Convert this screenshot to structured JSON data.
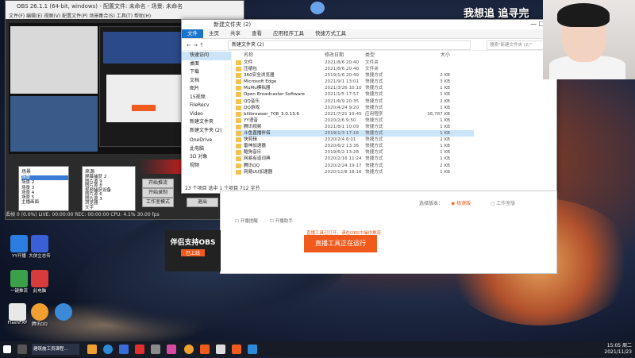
{
  "obs": {
    "title": "OBS 26.1.1 (64-bit, windows) - 配置文件: 未命名 - 场景: 未命名",
    "menu": "文件(F)  编辑(E)  视图(V)  配置文件(P)  场景集合(S)  工具(T)  帮助(H)",
    "scenes_header": "场景",
    "sources_header": "来源",
    "scenes": [
      "场景",
      "场景 2",
      "场景 3",
      "场景 4",
      "场景 5",
      "主播画面",
      "全屏游戏"
    ],
    "sources": [
      "屏幕捕获 2",
      "图片源 9",
      "图片源 8",
      "视频捕获设备",
      "图片源 6",
      "图片源 3",
      "浏览器",
      "文字",
      "文本(GDI+) 2"
    ],
    "controls": [
      "开始推流",
      "开始录制",
      "工作室模式",
      "设置",
      "退出"
    ],
    "status": "丢帧 0 (0.0%)  LIVE: 00:00:00  REC: 00:00:00  CPU: 4.1%  30.00 fps"
  },
  "explorer": {
    "title": "新建文件夹 (2)",
    "tabs": [
      "文件",
      "主页",
      "共享",
      "查看",
      "应用程序工具",
      "快捷方式工具"
    ],
    "path": "新建文件夹 (2)",
    "search_placeholder": "搜索\"新建文件夹 (2)\"",
    "columns": {
      "name": "名称",
      "date": "修改日期",
      "type": "类型",
      "size": "大小"
    },
    "sidebar": [
      "快速访问",
      "桌面",
      "下载",
      "文档",
      "图片",
      "15视频",
      "FileRecv",
      "Video",
      "新建文件夹",
      "新建文件夹 (2)",
      "OneDrive",
      "此电脑",
      "3D 对象",
      "视频"
    ],
    "files": [
      {
        "name": "文件",
        "date": "2021/8/6 20:40",
        "type": "文件夹",
        "size": ""
      },
      {
        "name": "压缩包",
        "date": "2021/8/6 20:40",
        "type": "文件夹",
        "size": ""
      },
      {
        "name": "360安全浏览器",
        "date": "2019/1/6 20:49",
        "type": "快捷方式",
        "size": "2 KB"
      },
      {
        "name": "Microsoft Edge",
        "date": "2021/9/1 13:01",
        "type": "快捷方式",
        "size": "3 KB"
      },
      {
        "name": "MuMu模拟器",
        "date": "2021/3/26 10:10",
        "type": "快捷方式",
        "size": "1 KB"
      },
      {
        "name": "Open Broadcaster Software",
        "date": "2021/1/5 17:57",
        "type": "快捷方式",
        "size": "1 KB"
      },
      {
        "name": "QQ音乐",
        "date": "2021/6/9 20:35",
        "type": "快捷方式",
        "size": "2 KB"
      },
      {
        "name": "QQ游戏",
        "date": "2020/4/24 9:20",
        "type": "快捷方式",
        "size": "1 KB"
      },
      {
        "name": "bilibrowser_708_3.0.13.6",
        "date": "2021/7/21 19:45",
        "type": "应用程序",
        "size": "36,787 KB"
      },
      {
        "name": "YY语音",
        "date": "2020/2/6 9:50",
        "type": "快捷方式",
        "size": "1 KB"
      },
      {
        "name": "腾讯视频",
        "date": "2021/8/1 10:09",
        "type": "快捷方式",
        "size": "1 KB"
      },
      {
        "name": "斗鱼直播伴侣",
        "date": "2019/1/3 17:16",
        "type": "快捷方式",
        "size": "1 KB"
      },
      {
        "name": "快剪辑",
        "date": "2020/2/4 8:01",
        "type": "快捷方式",
        "size": "2 KB"
      },
      {
        "name": "雷神加速器",
        "date": "2020/6/2 13:36",
        "type": "快捷方式",
        "size": "1 KB"
      },
      {
        "name": "酷狗音乐",
        "date": "2019/6/2 13:28",
        "type": "快捷方式",
        "size": "1 KB"
      },
      {
        "name": "网易有道词典",
        "date": "2020/2/16 11:24",
        "type": "快捷方式",
        "size": "1 KB"
      },
      {
        "name": "腾讯QQ",
        "date": "2020/2/24 19:17",
        "type": "快捷方式",
        "size": "2 KB"
      },
      {
        "name": "网易UU加速器",
        "date": "2020/12/8 18:16",
        "type": "快捷方式",
        "size": "1 KB"
      }
    ],
    "status": "23 个项目   选中 1 个项目 712 字节"
  },
  "browser": {
    "label_select": "选择版本：",
    "option1": "极速版",
    "option2": "工作室版",
    "checkbox1": "开播提醒",
    "checkbox2": "开播助手",
    "notice": "直播工具已打开，请在OBS中操作推流",
    "run_button": "直播工具正在运行"
  },
  "ad": {
    "line1": "伴侣支持OBS",
    "line2": "已上线"
  },
  "banner": "我想追 追寻完",
  "desktop_icons": [
    "YY开播",
    "大侠立志传",
    "一键推流",
    "此电脑",
    "FlashFXP",
    "腾讯QQ"
  ],
  "taskbar": {
    "app_label": "建筑施工员课程...",
    "time": "15:05 周二",
    "date": "2021/11/23"
  }
}
